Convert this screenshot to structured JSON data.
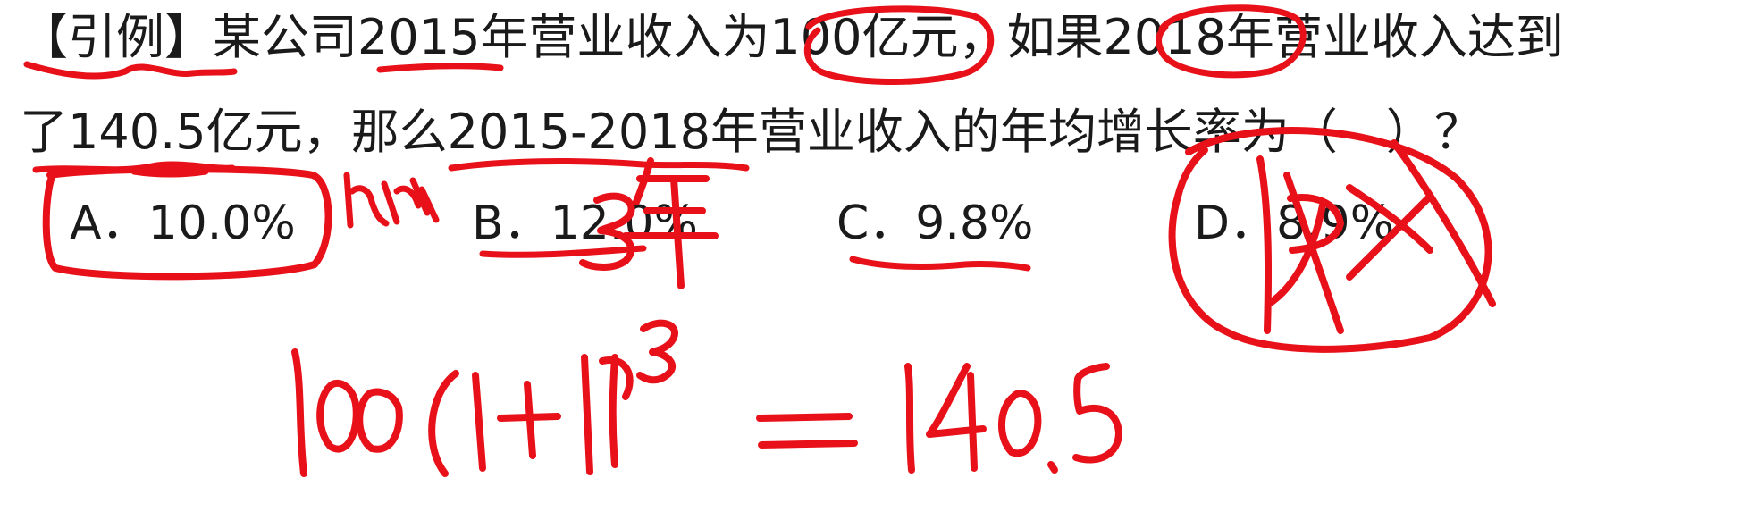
{
  "question": {
    "line1": "【引例】某公司2015年营业收入为100亿元，如果2018年营业收入达到",
    "line2": "了140.5亿元，那么2015-2018年营业收入的年均增长率为（　）？"
  },
  "options": [
    {
      "label": "A．10.0%"
    },
    {
      "label": "B．12.0%"
    },
    {
      "label": "C．9.8%"
    },
    {
      "label": "D．8.9%"
    }
  ],
  "handwriting": {
    "equation": "100(1+r)³ = 140.5",
    "note_years": "3年",
    "note_d": "R×"
  },
  "colors": {
    "text": "#1a1a1a",
    "annotation": "#e8111a",
    "background": "#ffffff"
  }
}
